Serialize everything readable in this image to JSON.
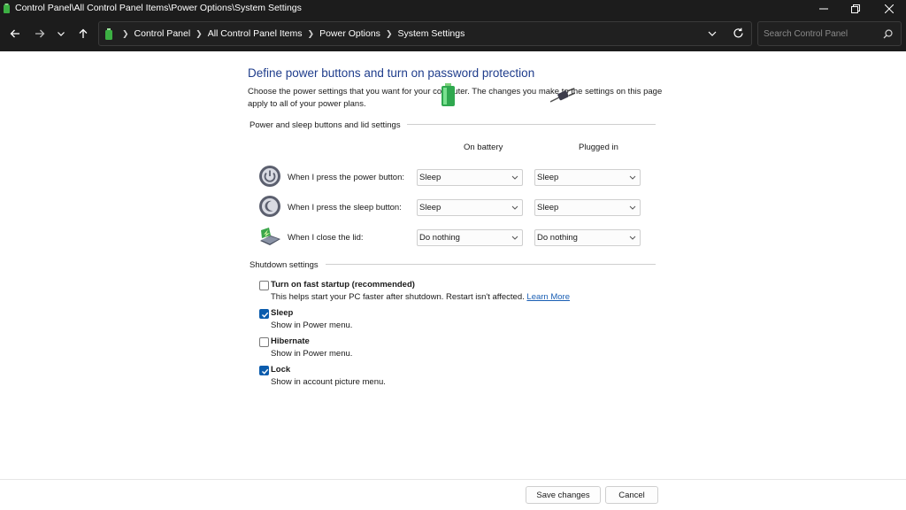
{
  "window": {
    "title": "Control Panel\\All Control Panel Items\\Power Options\\System Settings"
  },
  "address_bar": {
    "breadcrumbs": [
      "Control Panel",
      "All Control Panel Items",
      "Power Options",
      "System Settings"
    ],
    "search_placeholder": "Search Control Panel"
  },
  "page": {
    "heading": "Define power buttons and turn on password protection",
    "description": "Choose the power settings that you want for your computer. The changes you make to the settings on this page apply to all of your power plans."
  },
  "power_section": {
    "title": "Power and sleep buttons and lid settings",
    "columns": [
      "On battery",
      "Plugged in"
    ],
    "rows": [
      {
        "label": "When I press the power button:",
        "icon": "power-button-icon",
        "on_battery": "Sleep",
        "plugged_in": "Sleep"
      },
      {
        "label": "When I press the sleep button:",
        "icon": "sleep-button-icon",
        "on_battery": "Sleep",
        "plugged_in": "Sleep"
      },
      {
        "label": "When I close the lid:",
        "icon": "laptop-lid-icon",
        "on_battery": "Do nothing",
        "plugged_in": "Do nothing"
      }
    ]
  },
  "shutdown_section": {
    "title": "Shutdown settings",
    "items": [
      {
        "label": "Turn on fast startup (recommended)",
        "description": "This helps start your PC faster after shutdown. Restart isn't affected.",
        "link": "Learn More",
        "checked": false
      },
      {
        "label": "Sleep",
        "description": "Show in Power menu.",
        "checked": true
      },
      {
        "label": "Hibernate",
        "description": "Show in Power menu.",
        "checked": false
      },
      {
        "label": "Lock",
        "description": "Show in account picture menu.",
        "checked": true
      }
    ]
  },
  "footer": {
    "save_label": "Save changes",
    "cancel_label": "Cancel"
  },
  "colors": {
    "titlebar_bg": "#1c1c1c",
    "heading": "#1f3d8c",
    "checkbox_checked": "#0b5cad",
    "link": "#1a5fb4"
  }
}
